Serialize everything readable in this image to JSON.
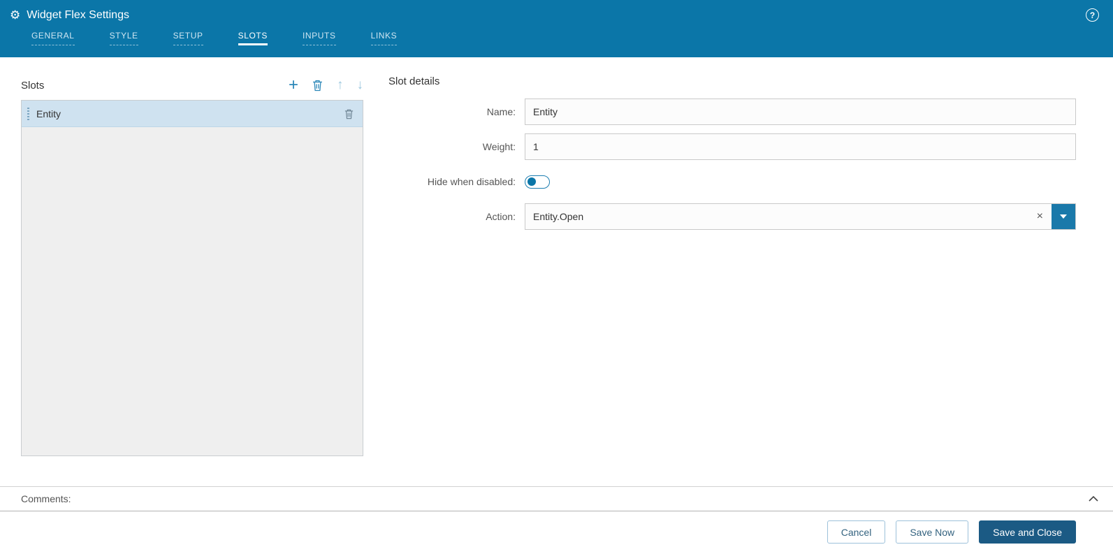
{
  "header": {
    "title": "Widget Flex Settings",
    "tabs": [
      {
        "label": "GENERAL",
        "active": false
      },
      {
        "label": "STYLE",
        "active": false
      },
      {
        "label": "SETUP",
        "active": false
      },
      {
        "label": "SLOTS",
        "active": true
      },
      {
        "label": "INPUTS",
        "active": false
      },
      {
        "label": "LINKS",
        "active": false
      }
    ]
  },
  "slots_panel": {
    "title": "Slots",
    "items": [
      {
        "name": "Entity",
        "selected": true
      }
    ]
  },
  "details": {
    "title": "Slot details",
    "name_label": "Name:",
    "name_value": "Entity",
    "weight_label": "Weight:",
    "weight_value": "1",
    "hide_label": "Hide when disabled:",
    "hide_value": "off",
    "action_label": "Action:",
    "action_value": "Entity.Open"
  },
  "comments": {
    "label": "Comments:"
  },
  "footer": {
    "cancel": "Cancel",
    "save_now": "Save Now",
    "save_close": "Save and Close"
  },
  "icons": {
    "gear": "⚙",
    "help": "?",
    "add": "+",
    "move_up": "↑",
    "move_down": "↓",
    "clear": "×"
  },
  "colors": {
    "header_bg": "#0b76a8",
    "accent": "#2b87b8",
    "selected_row": "#cfe2f0",
    "primary_button": "#1b5a84"
  }
}
